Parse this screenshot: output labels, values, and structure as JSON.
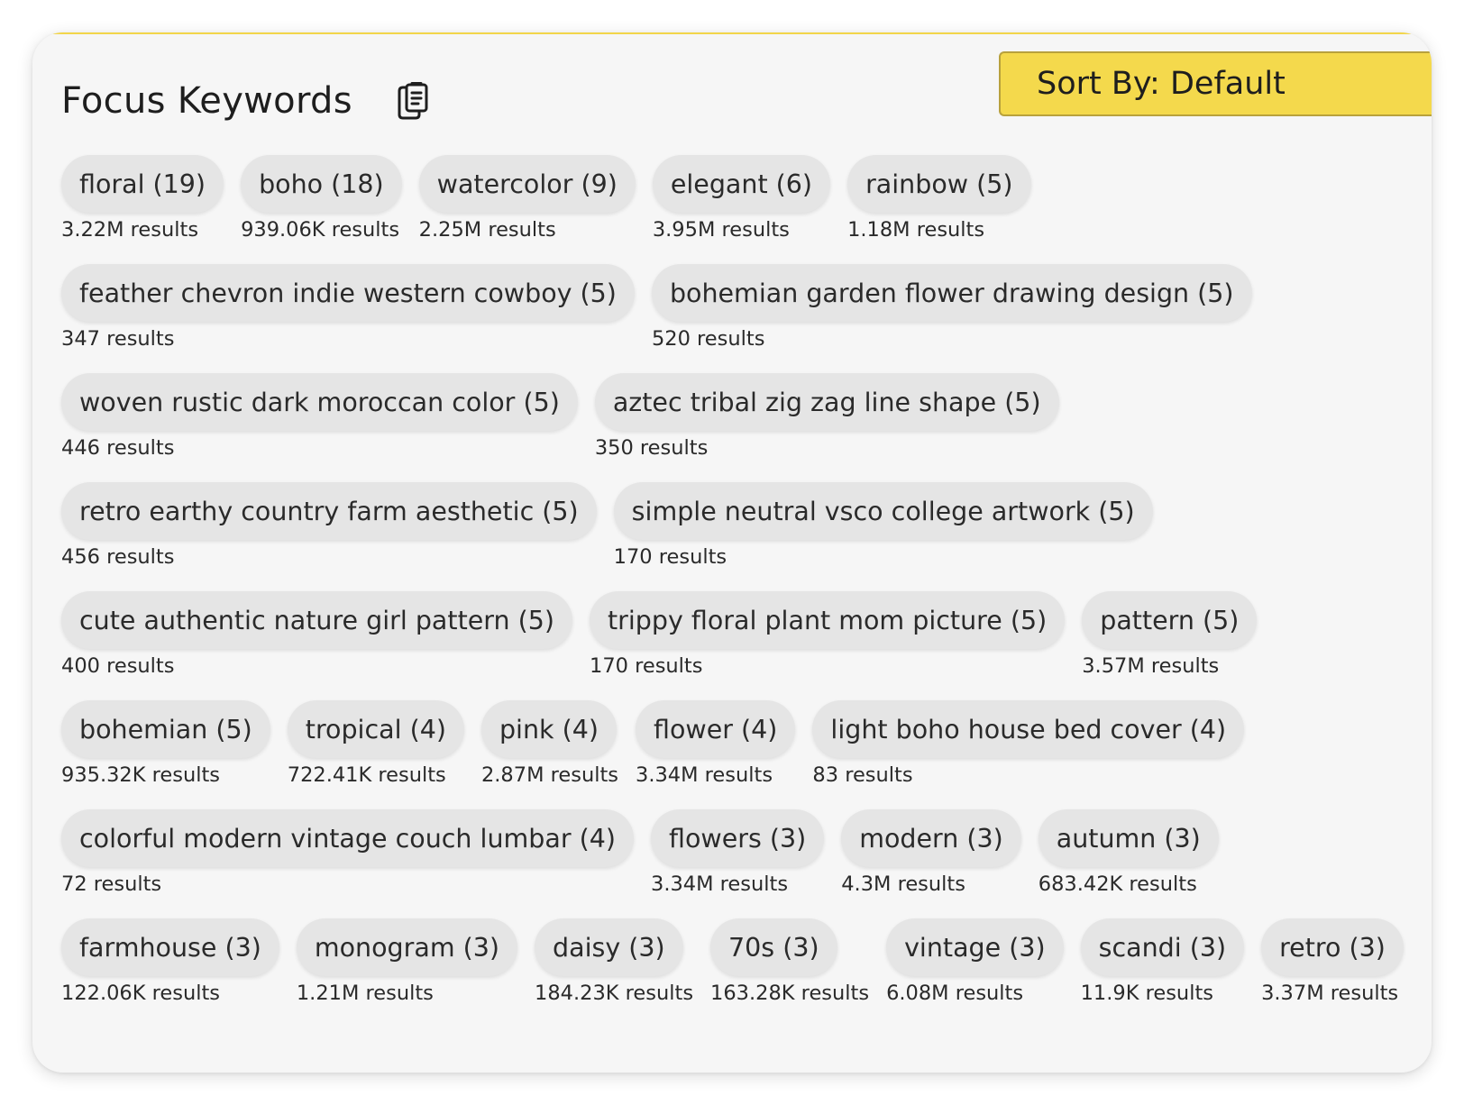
{
  "header": {
    "title": "Focus Keywords",
    "copy_icon": "clipboard-copy-icon",
    "sort_label": "Sort By: Default"
  },
  "colors": {
    "card_bg": "#f6f6f6",
    "chip_bg": "#e5e5e5",
    "sort_bg": "#f4d94c"
  },
  "keywords": [
    {
      "label": "floral (19)",
      "results": "3.22M results"
    },
    {
      "label": "boho (18)",
      "results": "939.06K results"
    },
    {
      "label": "watercolor (9)",
      "results": "2.25M results"
    },
    {
      "label": "elegant (6)",
      "results": "3.95M results"
    },
    {
      "label": "rainbow (5)",
      "results": "1.18M results"
    },
    {
      "label": "feather chevron indie western cowboy (5)",
      "results": "347 results"
    },
    {
      "label": "bohemian garden flower drawing design (5)",
      "results": "520 results"
    },
    {
      "label": "woven rustic dark moroccan color (5)",
      "results": "446 results"
    },
    {
      "label": "aztec tribal zig zag line shape (5)",
      "results": "350 results"
    },
    {
      "label": "retro earthy country farm aesthetic (5)",
      "results": "456 results"
    },
    {
      "label": "simple neutral vsco college artwork (5)",
      "results": "170 results"
    },
    {
      "label": "cute authentic nature girl pattern (5)",
      "results": "400 results"
    },
    {
      "label": "trippy floral plant mom picture (5)",
      "results": "170 results"
    },
    {
      "label": "pattern (5)",
      "results": "3.57M results"
    },
    {
      "label": "bohemian (5)",
      "results": "935.32K results"
    },
    {
      "label": "tropical (4)",
      "results": "722.41K results"
    },
    {
      "label": "pink (4)",
      "results": "2.87M results"
    },
    {
      "label": "flower (4)",
      "results": "3.34M results"
    },
    {
      "label": "light boho house bed cover (4)",
      "results": "83 results"
    },
    {
      "label": "colorful modern vintage couch lumbar (4)",
      "results": "72 results"
    },
    {
      "label": "flowers (3)",
      "results": "3.34M results"
    },
    {
      "label": "modern (3)",
      "results": "4.3M results"
    },
    {
      "label": "autumn (3)",
      "results": "683.42K results"
    },
    {
      "label": "farmhouse (3)",
      "results": "122.06K results"
    },
    {
      "label": "monogram (3)",
      "results": "1.21M results"
    },
    {
      "label": "daisy (3)",
      "results": "184.23K results"
    },
    {
      "label": "70s (3)",
      "results": "163.28K results"
    },
    {
      "label": "vintage (3)",
      "results": "6.08M results"
    },
    {
      "label": "scandi (3)",
      "results": "11.9K results"
    },
    {
      "label": "retro (3)",
      "results": "3.37M results"
    }
  ]
}
